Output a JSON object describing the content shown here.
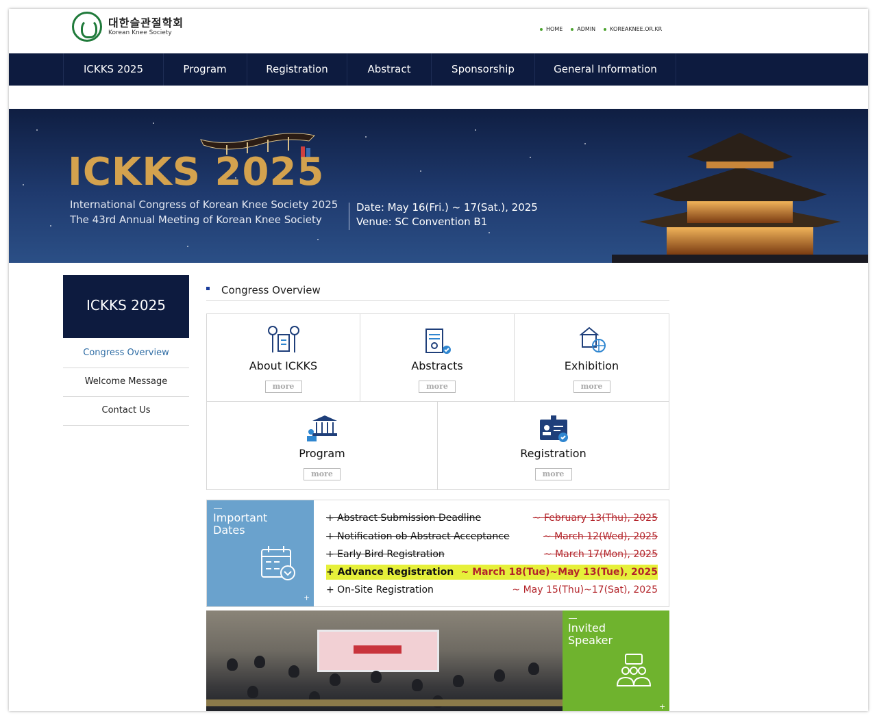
{
  "header": {
    "logo_ko": "대한슬관절학회",
    "logo_en": "Korean Knee Society",
    "util_links": [
      "HOME",
      "ADMIN",
      "KOREAKNEE.OR.KR"
    ]
  },
  "nav": [
    "ICKKS 2025",
    "Program",
    "Registration",
    "Abstract",
    "Sponsorship",
    "General Information"
  ],
  "banner": {
    "title": "ICKKS 2025",
    "subtitle1": "International Congress of Korean Knee Society 2025",
    "subtitle2": "The 43rd Annual Meeting of Korean Knee Society",
    "date": "Date: May 16(Fri.) ~ 17(Sat.), 2025",
    "venue": "Venue: SC Convention B1"
  },
  "sidebar": {
    "title": "ICKKS 2025",
    "items": [
      "Congress Overview",
      "Welcome Message",
      "Contact Us"
    ]
  },
  "main": {
    "section_title": "Congress Overview",
    "more_label": "more",
    "cards": [
      "About ICKKS",
      "Abstracts",
      "Exhibition",
      "Program",
      "Registration"
    ]
  },
  "important_dates": {
    "title_line1": "Important",
    "title_line2": "Dates",
    "plus": "+",
    "rows": [
      {
        "label": "+ Abstract Submission Deadline",
        "date": "~ February 13(Thu), 2025"
      },
      {
        "label": "+ Notification ob Abstract Acceptance",
        "date": "~ March 12(Wed), 2025"
      },
      {
        "label": "+ Early Bird Registration",
        "date": "~ March 17(Mon), 2025"
      },
      {
        "label": "+ Advance Registration",
        "date": "~ March 18(Tue)~May 13(Tue), 2025"
      },
      {
        "label": "+ On-Site Registration",
        "date": "~ May 15(Thu)~17(Sat), 2025"
      }
    ]
  },
  "invited": {
    "title_line1": "Invited",
    "title_line2": "Speaker",
    "plus": "+"
  },
  "colors": {
    "navy": "#0d1b3f",
    "accent_blue": "#2e6ca4",
    "important_blue": "#6aa2cd",
    "invited_green": "#6fb32e",
    "date_red": "#b3242a",
    "highlight": "#e6f03a"
  }
}
